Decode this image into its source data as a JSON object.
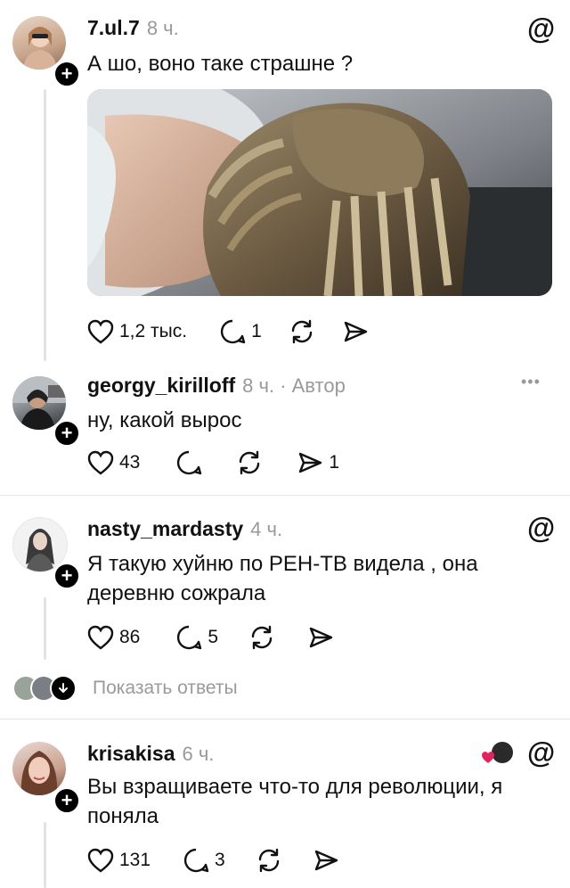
{
  "posts": [
    {
      "username": "7.ul.7",
      "time": "8 ч.",
      "text": "А шо, воно таке страшне ?",
      "likes": "1,2 тыс.",
      "replies": "1",
      "reposts": "",
      "shares": ""
    },
    {
      "username": "georgy_kirilloff",
      "time": "8 ч. · Автор",
      "text": "ну, какой вырос",
      "likes": "43",
      "replies": "",
      "reposts": "",
      "shares": "1"
    },
    {
      "username": "nasty_mardasty",
      "time": "4 ч.",
      "text_lines": [
        "Я такую хуйню по РЕН-ТВ видела , она",
        "деревню сожрала"
      ],
      "likes": "86",
      "replies": "5",
      "reposts": "",
      "shares": ""
    },
    {
      "username": "krisakisa",
      "time": "6 ч.",
      "text_lines": [
        "Вы взращиваете что-то для революции, я",
        "поняла"
      ],
      "likes": "131",
      "replies": "3",
      "reposts": "",
      "shares": ""
    }
  ],
  "show_replies_label": "Показать ответы",
  "more_menu_glyph": "•••",
  "threads_logo_glyph": "@",
  "icons": {
    "like": "heart-icon",
    "reply": "comment-icon",
    "repost": "repost-icon",
    "share": "share-icon",
    "follow": "plus-icon",
    "threads": "threads-logo-icon",
    "more": "more-options-icon"
  },
  "colors": {
    "text": "#111111",
    "muted": "#999999",
    "divider": "#e6e6e6",
    "like_red": "#e0245e"
  }
}
